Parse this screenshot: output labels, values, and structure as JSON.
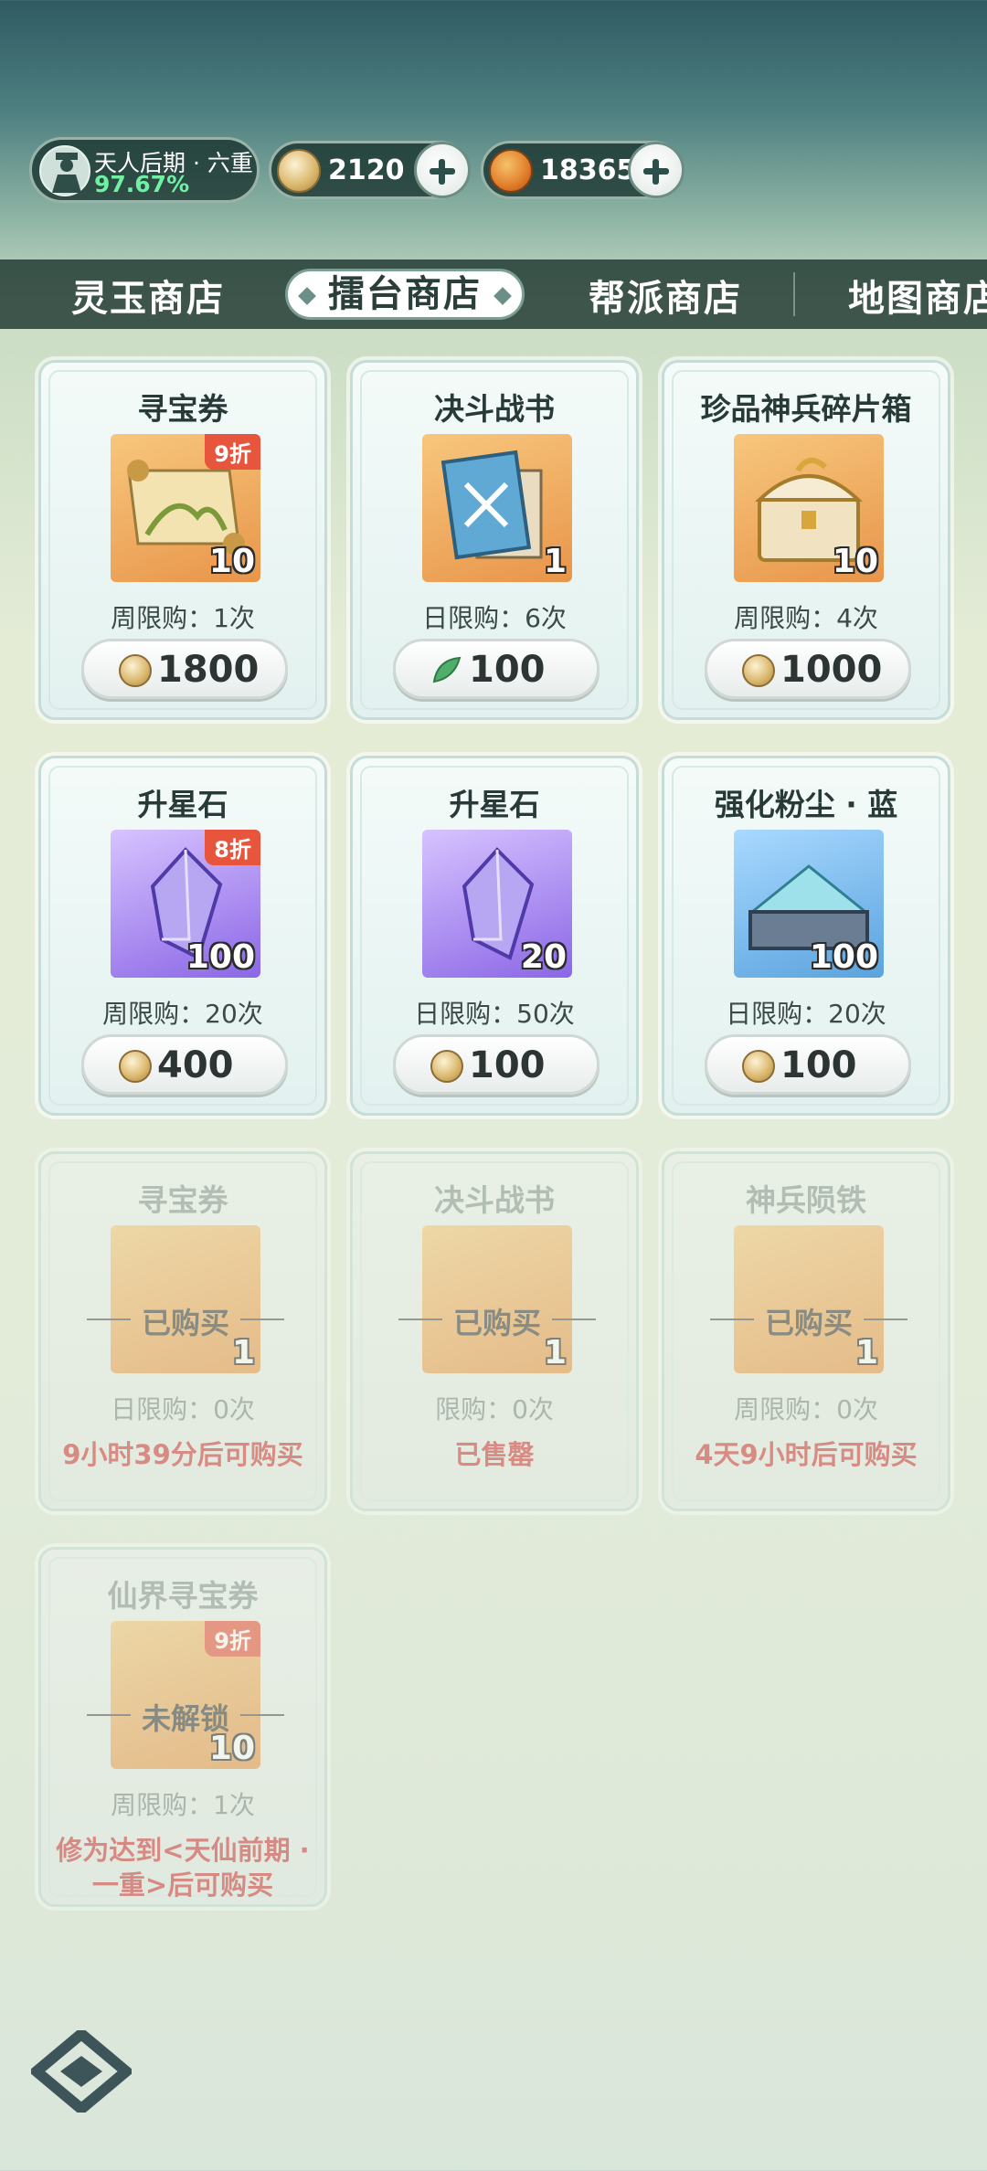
{
  "status": {
    "realm": "天人后期 · 六重",
    "progress": "97.67%",
    "currency1": "2120",
    "currency2": "18365"
  },
  "tabs": [
    "灵玉商店",
    "擂台商店",
    "帮派商店",
    "地图商店"
  ],
  "cards": [
    {
      "title": "寻宝券",
      "qty": "10",
      "badge": "9折",
      "limit": "周限购：1次",
      "price": "1800"
    },
    {
      "title": "决斗战书",
      "qty": "1",
      "limit": "日限购：6次",
      "price": "100"
    },
    {
      "title": "珍品神兵碎片箱",
      "qty": "10",
      "limit": "周限购：4次",
      "price": "1000"
    },
    {
      "title": "升星石",
      "qty": "100",
      "badge": "8折",
      "limit": "周限购：20次",
      "price": "400"
    },
    {
      "title": "升星石",
      "qty": "20",
      "limit": "日限购：50次",
      "price": "100"
    },
    {
      "title": "强化粉尘 · 蓝",
      "qty": "100",
      "limit": "日限购：20次",
      "price": "100"
    },
    {
      "title": "寻宝券",
      "qty": "1",
      "overlay": "已购买",
      "limit": "日限购：0次",
      "state": "9小时39分后可购买"
    },
    {
      "title": "决斗战书",
      "qty": "1",
      "overlay": "已购买",
      "limit": "限购：0次",
      "state": "已售罄"
    },
    {
      "title": "神兵陨铁",
      "qty": "1",
      "overlay": "已购买",
      "limit": "周限购：0次",
      "state": "4天9小时后可购买"
    },
    {
      "title": "仙界寻宝券",
      "qty": "10",
      "badge": "9折",
      "overlay": "未解锁",
      "limit": "周限购：1次",
      "state": "修为达到<天仙前期 · 一重>后可购买"
    }
  ]
}
